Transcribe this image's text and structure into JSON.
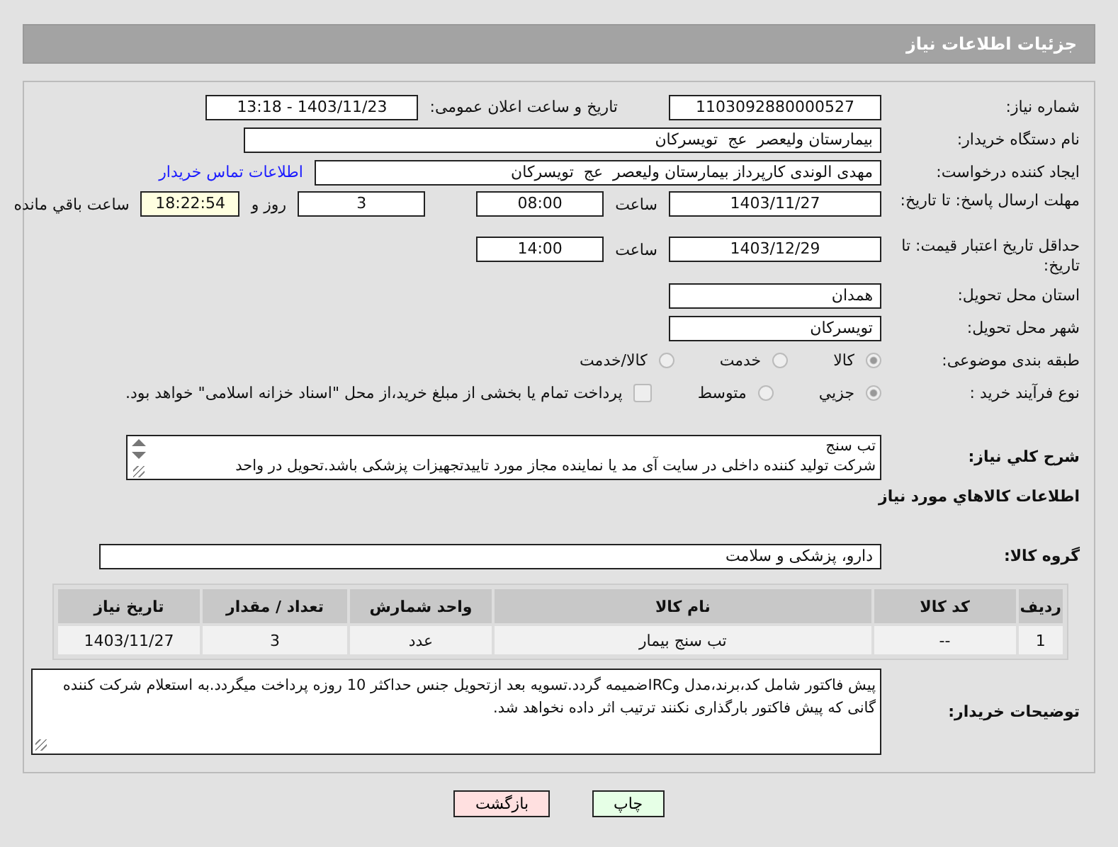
{
  "header": {
    "title": "جزئیات اطلاعات نیاز"
  },
  "need_number": {
    "label": "شماره نیاز:",
    "value": "1103092880000527"
  },
  "announce": {
    "label": "تاریخ و ساعت اعلان عمومی:",
    "value": "1403/11/23 - 13:18"
  },
  "buyer": {
    "label": "نام دستگاه خریدار:",
    "value": "بیمارستان ولیعصر  عج  تویسرکان"
  },
  "requester": {
    "label": "ایجاد کننده درخواست:",
    "value": "مهدی الوندی کارپرداز بیمارستان ولیعصر  عج  تویسرکان",
    "link": "اطلاعات تماس خریدار"
  },
  "deadline": {
    "label": "مهلت ارسال پاسخ: تا تاریخ:",
    "date": "1403/11/27",
    "time_label": "ساعت",
    "time": "08:00",
    "days": "3",
    "days_label": "روز و",
    "remaining": "18:22:54",
    "remaining_label": "ساعت باقي مانده"
  },
  "validity": {
    "label": "حداقل تاریخ اعتبار قیمت: تا تاریخ:",
    "date": "1403/12/29",
    "time_label": "ساعت",
    "time": "14:00"
  },
  "province": {
    "label": "استان محل تحویل:",
    "value": "همدان"
  },
  "city": {
    "label": "شهر محل تحویل:",
    "value": "تویسرکان"
  },
  "category": {
    "label": "طبقه بندی موضوعی:",
    "options": [
      {
        "label": "کالا",
        "selected": true
      },
      {
        "label": "خدمت",
        "selected": false
      },
      {
        "label": "کالا/خدمت",
        "selected": false
      }
    ]
  },
  "process": {
    "label": "نوع فرآیند خرید :",
    "options": [
      {
        "label": "جزیي",
        "selected": true
      },
      {
        "label": "متوسط",
        "selected": false
      }
    ],
    "payment": {
      "checked": false,
      "label": "پرداخت تمام یا بخشی از مبلغ خرید،از محل \"اسناد خزانه اسلامی\" خواهد بود."
    }
  },
  "description": {
    "label": "شرح کلي نیاز:",
    "lines": [
      "تب سنج",
      "شرکت تولید کننده داخلی در سایت آی مد یا نماینده مجاز مورد تاییدتجهیزات پزشکی باشد.تحویل در واحد"
    ]
  },
  "items_title": "اطلاعات کالاهاي مورد نیاز",
  "group": {
    "label": "گروه کالا:",
    "value": "دارو، پزشکی و سلامت"
  },
  "table": {
    "columns": [
      "ردیف",
      "کد کالا",
      "نام کالا",
      "واحد شمارش",
      "تعداد / مقدار",
      "تاریخ نیاز"
    ],
    "rows": [
      [
        "1",
        "--",
        "تب سنج بیمار",
        "عدد",
        "3",
        "1403/11/27"
      ]
    ]
  },
  "notes": {
    "label": "توضیحات خریدار:",
    "value": "پیش فاکتور شامل کد،برند،مدل وIRCضمیمه گردد.تسویه بعد ازتحویل جنس حداکثر 10 روزه پرداخت میگردد.به استعلام شرکت کننده گانی که پیش فاکتور بارگذاری نکنند ترتیب اثر داده نخواهد شد."
  },
  "buttons": [
    {
      "label": "چاپ",
      "kind": "print"
    },
    {
      "label": "بازگشت",
      "kind": "back"
    }
  ]
}
